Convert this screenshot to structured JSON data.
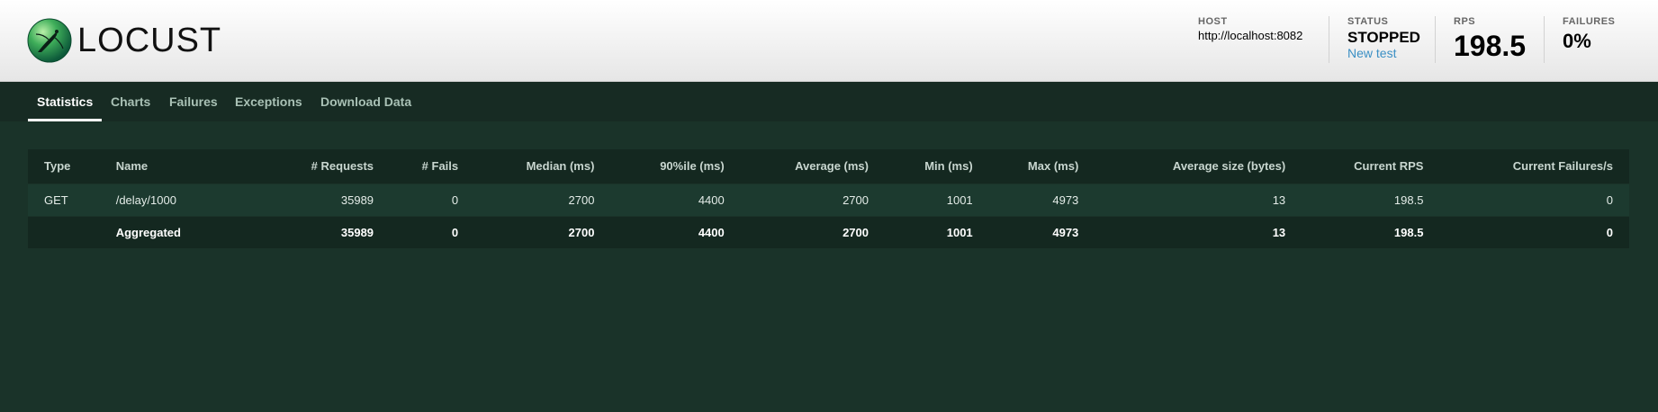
{
  "app": {
    "name": "LOCUST",
    "logo_icon": "locust-logo-icon"
  },
  "header": {
    "host": {
      "label": "HOST",
      "value": "http://localhost:8082"
    },
    "status": {
      "label": "STATUS",
      "value": "STOPPED",
      "link": "New test"
    },
    "rps": {
      "label": "RPS",
      "value": "198.5"
    },
    "failures": {
      "label": "FAILURES",
      "value": "0%"
    }
  },
  "tabs": [
    {
      "label": "Statistics",
      "active": true
    },
    {
      "label": "Charts",
      "active": false
    },
    {
      "label": "Failures",
      "active": false
    },
    {
      "label": "Exceptions",
      "active": false
    },
    {
      "label": "Download Data",
      "active": false
    }
  ],
  "table": {
    "columns": [
      "Type",
      "Name",
      "# Requests",
      "# Fails",
      "Median (ms)",
      "90%ile (ms)",
      "Average (ms)",
      "Min (ms)",
      "Max (ms)",
      "Average size (bytes)",
      "Current RPS",
      "Current Failures/s"
    ],
    "rows": [
      [
        "GET",
        "/delay/1000",
        "35989",
        "0",
        "2700",
        "4400",
        "2700",
        "1001",
        "4973",
        "13",
        "198.5",
        "0"
      ]
    ],
    "aggregate": [
      "",
      "Aggregated",
      "35989",
      "0",
      "2700",
      "4400",
      "2700",
      "1001",
      "4973",
      "13",
      "198.5",
      "0"
    ]
  },
  "colors": {
    "background": "#1a3329",
    "header_bg": "#f2f2f2",
    "link": "#3b8fc4"
  }
}
